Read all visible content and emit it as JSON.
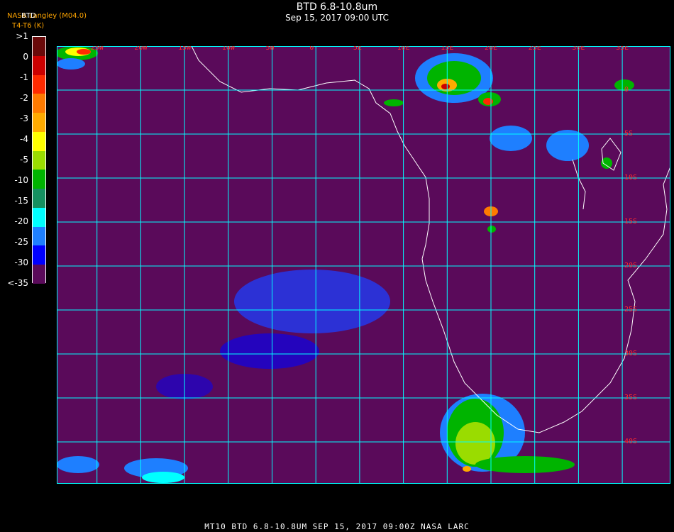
{
  "header": {
    "title": "BTD 6.8-10.8um",
    "subtitle": "Sep 15, 2017 09:00 UTC",
    "credit": "NASA Langley (M04.0)",
    "units": "T4-T6 (K)",
    "label_btd": "BTD"
  },
  "colorbar": {
    "labels": [
      ">1",
      "0",
      "-1",
      "-2",
      "-3",
      "-4",
      "-5",
      "-10",
      "-15",
      "-20",
      "-25",
      "-30",
      "<-35"
    ],
    "colors": [
      "#6a0a0a",
      "#cc0000",
      "#ff2a00",
      "#ff7a00",
      "#ffaa00",
      "#ffff00",
      "#9adc00",
      "#00b400",
      "#159060",
      "#00ffff",
      "#1e7fff",
      "#0000ff",
      "#5a0a5a"
    ]
  },
  "map": {
    "background": "#5a0a5a",
    "grid_color": "#00ffff",
    "coast_color": "#ffffff",
    "lon_labels": [
      "25W",
      "20W",
      "15W",
      "10W",
      "5W",
      "0",
      "5E",
      "10E",
      "15E",
      "20E",
      "25E",
      "30E",
      "35E"
    ],
    "lat_labels": [
      "0",
      "5S",
      "10S",
      "15S",
      "20S",
      "25S",
      "30S",
      "35S",
      "40S"
    ]
  },
  "footer": "MT10  BTD 6.8-10.8UM   SEP 15, 2017 09:00Z   NASA LARC"
}
